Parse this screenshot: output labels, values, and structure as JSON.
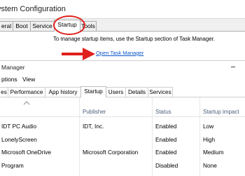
{
  "sysconfig": {
    "title": "ystem Configuration",
    "tabs": [
      "eral",
      "Boot",
      "Service",
      "Startup",
      "Tools"
    ],
    "active_tab": "Startup",
    "info_text": "To manage startup items, use the Startup section of Task Manager.",
    "open_link": "Open Task Manager"
  },
  "taskmgr": {
    "title": "Manager",
    "menu": [
      "ptions",
      "View"
    ],
    "tabs": [
      "es",
      "Performance",
      "App history",
      "Startup",
      "Users",
      "Details",
      "Services"
    ],
    "active_tab": "Startup",
    "columns": [
      "Publisher",
      "Status",
      "Startup impact"
    ],
    "rows": [
      {
        "name": "IDT PC Audio",
        "publisher": "IDT, Inc.",
        "status": "Enabled",
        "impact": "Low"
      },
      {
        "name": "LonelyScreen",
        "publisher": "",
        "status": "Enabled",
        "impact": "High"
      },
      {
        "name": "Microsoft OneDrive",
        "publisher": "Microsoft Corporation",
        "status": "Enabled",
        "impact": "Medium"
      },
      {
        "name": "Program",
        "publisher": "",
        "status": "Disabled",
        "impact": "None"
      }
    ]
  },
  "annotation_color": "#e0201c",
  "link_color": "#0b57c9"
}
